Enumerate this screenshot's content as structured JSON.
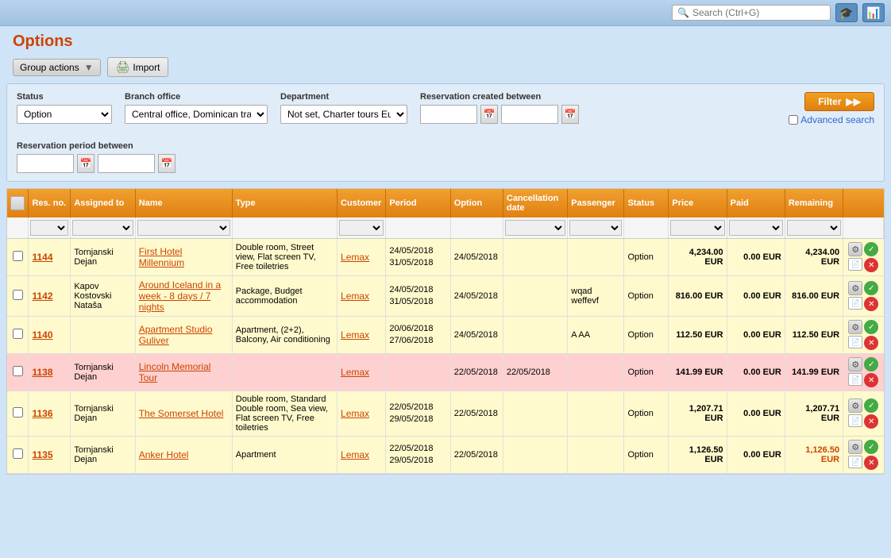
{
  "topbar": {
    "search_placeholder": "Search (Ctrl+G)"
  },
  "page_title": "Options",
  "toolbar": {
    "group_actions_label": "Group actions",
    "import_label": "Import"
  },
  "filters": {
    "status_label": "Status",
    "status_value": "Option",
    "branch_label": "Branch office",
    "branch_value": "Central office, Dominican travel n",
    "dept_label": "Department",
    "dept_value": "Not set, Charter tours Europe, Ch",
    "res_created_label": "Reservation created between",
    "res_period_label": "Reservation period between",
    "filter_btn_label": "Filter",
    "advanced_search_label": "Advanced search"
  },
  "table": {
    "columns": [
      "Res. no.",
      "Assigned to",
      "Name",
      "Type",
      "Customer",
      "Period",
      "Option",
      "Cancellation date",
      "Passenger",
      "Status",
      "Price",
      "Paid",
      "Remaining"
    ],
    "rows": [
      {
        "res_no": "1144",
        "assigned": "Tornjanski Dejan",
        "name": "First Hotel Millennium",
        "type": "Double room, Street view, Flat screen TV, Free toiletries",
        "customer": "Lemax",
        "period": "24/05/2018 - 31/05/2018",
        "option": "24/05/2018",
        "cancellation": "",
        "passenger": "",
        "status": "Option",
        "price": "4,234.00 EUR",
        "paid": "0.00 EUR",
        "remaining": "4,234.00 EUR",
        "remaining_orange": false,
        "row_class": "row-yellow"
      },
      {
        "res_no": "1142",
        "assigned": "Kapov Kostovski Nataša",
        "name": "Around Iceland in a week - 8 days / 7 nights",
        "type": "Package, Budget accommodation",
        "customer": "Lemax",
        "period": "24/05/2018 - 31/05/2018",
        "option": "24/05/2018",
        "cancellation": "",
        "passenger": "wqad weffevf",
        "status": "Option",
        "price": "816.00 EUR",
        "paid": "0.00 EUR",
        "remaining": "816.00 EUR",
        "remaining_orange": false,
        "row_class": "row-yellow"
      },
      {
        "res_no": "1140",
        "assigned": "",
        "name": "Apartment Studio Guliver",
        "type": "Apartment, (2+2), Balcony, Air conditioning",
        "customer": "Lemax",
        "period": "20/06/2018 - 27/06/2018",
        "option": "24/05/2018",
        "cancellation": "",
        "passenger": "A AA",
        "status": "Option",
        "price": "112.50 EUR",
        "paid": "0.00 EUR",
        "remaining": "112.50 EUR",
        "remaining_orange": false,
        "row_class": "row-yellow"
      },
      {
        "res_no": "1138",
        "assigned": "Tornjanski Dejan",
        "name": "Lincoln Memorial Tour",
        "type": "",
        "customer": "Lemax",
        "period": "",
        "option": "22/05/2018",
        "cancellation": "22/05/2018",
        "passenger": "",
        "status": "Option",
        "price": "141.99 EUR",
        "paid": "0.00 EUR",
        "remaining": "141.99 EUR",
        "remaining_orange": false,
        "row_class": "row-pink"
      },
      {
        "res_no": "1136",
        "assigned": "Tornjanski Dejan",
        "name": "The Somerset Hotel",
        "type": "Double room, Standard Double room, Sea view, Flat screen TV, Free toiletries",
        "customer": "Lemax",
        "period": "22/05/2018 - 29/05/2018",
        "option": "22/05/2018",
        "cancellation": "",
        "passenger": "",
        "status": "Option",
        "price": "1,207.71 EUR",
        "paid": "0.00 EUR",
        "remaining": "1,207.71 EUR",
        "remaining_orange": false,
        "row_class": "row-yellow"
      },
      {
        "res_no": "1135",
        "assigned": "Tornjanski Dejan",
        "name": "Anker Hotel",
        "type": "Apartment",
        "customer": "Lemax",
        "period": "22/05/2018 - 29/05/2018",
        "option": "22/05/2018",
        "cancellation": "",
        "passenger": "",
        "status": "Option",
        "price": "1,126.50 EUR",
        "paid": "0.00 EUR",
        "remaining": "1,126.50 EUR",
        "remaining_orange": true,
        "row_class": "row-yellow"
      }
    ]
  }
}
